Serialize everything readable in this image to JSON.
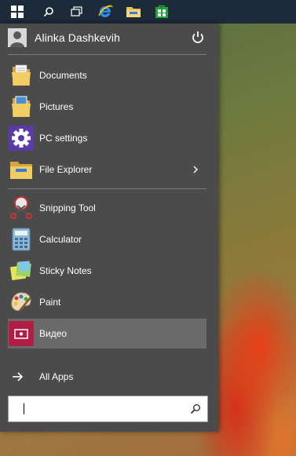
{
  "user": {
    "name": "Alinka Dashkevih"
  },
  "menu_items": [
    {
      "label": "Documents",
      "icon": "documents-folder-icon"
    },
    {
      "label": "Pictures",
      "icon": "pictures-folder-icon"
    },
    {
      "label": "PC settings",
      "icon": "pc-settings-gear-icon"
    },
    {
      "label": "File Explorer",
      "icon": "file-explorer-icon",
      "has_submenu": true
    }
  ],
  "app_items": [
    {
      "label": "Snipping Tool",
      "icon": "snipping-tool-icon"
    },
    {
      "label": "Calculator",
      "icon": "calculator-icon"
    },
    {
      "label": "Sticky Notes",
      "icon": "sticky-notes-icon"
    },
    {
      "label": "Paint",
      "icon": "paint-icon"
    },
    {
      "label": "Видео",
      "icon": "video-icon",
      "selected": true
    }
  ],
  "all_apps": {
    "label": "All Apps"
  },
  "search": {
    "value": "",
    "placeholder": ""
  },
  "taskbar": {
    "buttons": [
      "start-windows-icon",
      "search-icon",
      "task-view-icon",
      "internet-explorer-icon",
      "file-explorer-icon",
      "store-icon"
    ]
  },
  "colors": {
    "taskbar": "#1c2a3a",
    "start_menu": "#4b4b4b",
    "selected_item": "#6a6a6a",
    "settings_accent": "#5b3aa8",
    "video_tile": "#b01e46"
  }
}
